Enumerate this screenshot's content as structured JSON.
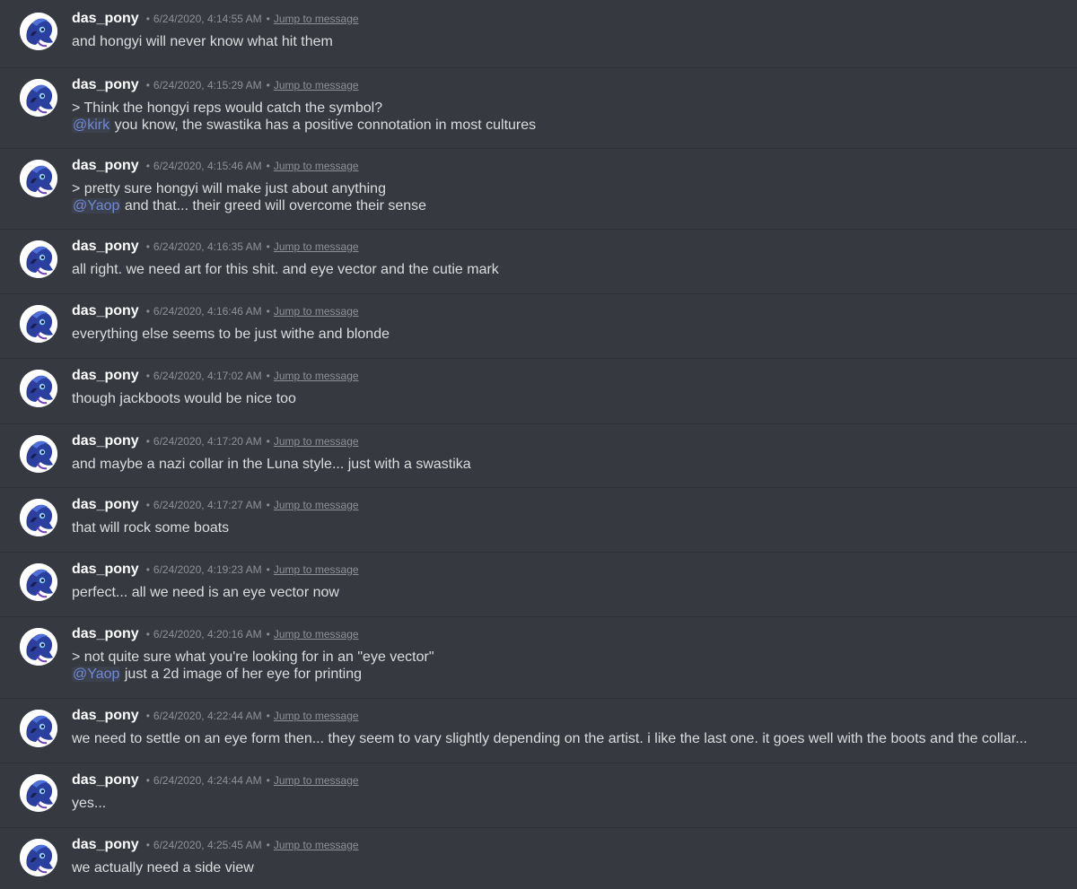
{
  "colors": {
    "background": "#36393f",
    "author": "#ffffff",
    "text": "#dcddde",
    "meta": "#8e9297",
    "mention": "#7289da",
    "divider": "#2e3136"
  },
  "avatar_icon": "pony-avatar-icon",
  "separator": "•",
  "messages": [
    {
      "author": "das_pony",
      "timestamp": "6/24/2020, 4:14:55 AM",
      "jump": "Jump to message",
      "lines": [
        {
          "text": "and hongyi will never know what hit them"
        }
      ]
    },
    {
      "author": "das_pony",
      "timestamp": "6/24/2020, 4:15:29 AM",
      "jump": "Jump to message",
      "lines": [
        {
          "text": "> Think the hongyi reps would catch the symbol?"
        },
        {
          "mention": "@kirk",
          "text": " you know, the swastika has a positive connotation in most cultures"
        }
      ]
    },
    {
      "author": "das_pony",
      "timestamp": "6/24/2020, 4:15:46 AM",
      "jump": "Jump to message",
      "lines": [
        {
          "text": "> pretty sure hongyi will make just about anything"
        },
        {
          "mention": "@Yaop",
          "text": " and that... their greed will overcome their sense"
        }
      ]
    },
    {
      "author": "das_pony",
      "timestamp": "6/24/2020, 4:16:35 AM",
      "jump": "Jump to message",
      "lines": [
        {
          "text": "all right. we need art for this shit. and eye vector and the cutie mark"
        }
      ]
    },
    {
      "author": "das_pony",
      "timestamp": "6/24/2020, 4:16:46 AM",
      "jump": "Jump to message",
      "lines": [
        {
          "text": "everything else seems to be just withe and blonde"
        }
      ]
    },
    {
      "author": "das_pony",
      "timestamp": "6/24/2020, 4:17:02 AM",
      "jump": "Jump to message",
      "lines": [
        {
          "text": "though jackboots would be nice too"
        }
      ]
    },
    {
      "author": "das_pony",
      "timestamp": "6/24/2020, 4:17:20 AM",
      "jump": "Jump to message",
      "lines": [
        {
          "text": "and maybe a nazi collar in the Luna style... just with a swastika"
        }
      ]
    },
    {
      "author": "das_pony",
      "timestamp": "6/24/2020, 4:17:27 AM",
      "jump": "Jump to message",
      "lines": [
        {
          "text": "that will rock some boats"
        }
      ]
    },
    {
      "author": "das_pony",
      "timestamp": "6/24/2020, 4:19:23 AM",
      "jump": "Jump to message",
      "lines": [
        {
          "text": "perfect... all we need is an eye vector now"
        }
      ]
    },
    {
      "author": "das_pony",
      "timestamp": "6/24/2020, 4:20:16 AM",
      "jump": "Jump to message",
      "lines": [
        {
          "text": "> not quite sure what you're looking for in an \"eye vector\""
        },
        {
          "mention": "@Yaop",
          "text": " just a 2d image of her eye for printing"
        }
      ]
    },
    {
      "author": "das_pony",
      "timestamp": "6/24/2020, 4:22:44 AM",
      "jump": "Jump to message",
      "lines": [
        {
          "text": "we need to settle on an eye form then... they seem to vary slightly depending on the artist. i like the last one. it goes well with the boots and the collar..."
        }
      ]
    },
    {
      "author": "das_pony",
      "timestamp": "6/24/2020, 4:24:44 AM",
      "jump": "Jump to message",
      "lines": [
        {
          "text": "yes..."
        }
      ]
    },
    {
      "author": "das_pony",
      "timestamp": "6/24/2020, 4:25:45 AM",
      "jump": "Jump to message",
      "lines": [
        {
          "text": "we actually need a side view"
        }
      ]
    }
  ]
}
